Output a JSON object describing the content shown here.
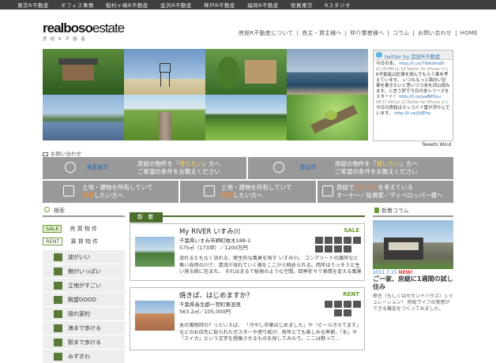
{
  "topnav": {
    "items": [
      "東京R不動産",
      "オフィス事情",
      "稲村ヶ崎R不動産",
      "金沢R不動産",
      "神戸R不動産",
      "福岡R不動産",
      "密買東京",
      "Rスタジオ"
    ]
  },
  "logo": {
    "main": "realboso",
    "main_suffix": "estate",
    "sub": "房総R不動産"
  },
  "headnav": {
    "items": [
      "房総R不動産について",
      "売主・貸主様へ",
      "仲介業者様へ",
      "コラム",
      "お問い合わせ",
      "HOME"
    ],
    "sep": "|"
  },
  "photos": {
    "count": 8
  },
  "twitter": {
    "header": "twitter by 房総R不動産",
    "tweets": [
      {
        "text": "今日の本。",
        "link": "http://t.co/7WkdmdX",
        "meta": "02:09 PM Jul 14 Twitter for iPhone から"
      },
      {
        "text": "R不動産は記事を読んでもらう事を考えています。 いつももっと面白い記事を書きたいと思いつつ本を沢山読みます。と言う訳で今日の本シリーズをスタート！",
        "link": "http://t.co/saB65xu",
        "meta": "09:37 AM Jul 12 Twitter for iPhone から"
      },
      {
        "text": "今日の房総はカッコイイ雲が浮かんでいます。",
        "link": "http://t.co/jVJEhy",
        "meta": ""
      }
    ],
    "footer": "Tweets Wind"
  },
  "inquiry": {
    "label": "お問い合わせ"
  },
  "banners": {
    "rent": {
      "label": "RENT",
      "line1_pre": "房総の物件を「",
      "line1_hl": "借りたい",
      "line1_post": "」方へ",
      "line2": "ご希望の条件をお教えください"
    },
    "buy": {
      "label": "BUY",
      "line1_pre": "房総の物件を「",
      "line1_hl": "買いたい",
      "line1_post": "」方へ",
      "line2": "ご希望の条件をお教えください"
    },
    "build": {
      "line1": "土地・建物を所有していて",
      "line2_hl": "建築",
      "line2_post": "したい方へ"
    },
    "sell": {
      "line1": "土地・建物を所有していて",
      "line2_hl": "売却",
      "line2_post": "したい方へ"
    },
    "biz": {
      "line1_pre": "房総で",
      "line1_hl": "ビジネス",
      "line1_post": "を考えている",
      "line2": "オーナー／投資家／ディベロッパー様へ"
    }
  },
  "sidebar": {
    "title": "検索",
    "sale": {
      "badge": "SALE",
      "label": "売 買 物 件"
    },
    "rent": {
      "badge": "RENT",
      "label": "賃 貸 物 件"
    },
    "categories": [
      "波がいい",
      "樹がいっぱい",
      "立地がすごい",
      "眺望GOOD",
      "隠れ家的",
      "海まで歩ける",
      "駅まで歩ける",
      "みずぎわ"
    ]
  },
  "main": {
    "title": "新 着",
    "cards": [
      {
        "title": "My RIVER いすみ川",
        "tag": "SALE",
        "address": "千葉県いすみ市岬町椎木188-1",
        "price": "575㎡（173坪）／1200万円",
        "desc": "流れるともなく流れる、原生的な風景を残す いすみ川。 コンクリートの護岸など無い自然の川で、清流が流れていく様をここから眺められる。両岸はうっそうと生い茂る緑に包まれ、 それはまるで秘境のような空間。四季折々で表情を変える風景が広がる。 川岸..."
      },
      {
        "title": "焼きぱ、はじめますか？",
        "tag": "RENT",
        "address": "千葉県長生郡一宮町東浪見",
        "price": "563.2㎡／105,000円",
        "desc": "夏の風物詩の？っといえば、 「冷やし中華はじめました」や「ビール冷えてます」などのお店先に貼られたポスターや張り紙が、毎年とても楽しみな季節。「氷」や「スイカ」という文字を想像させるものを探してみたり、ここは黙って..."
      }
    ]
  },
  "right": {
    "title": "新着コラム",
    "date": "2011.7.15",
    "date_new": "NEW!",
    "headline": "ご一家、房総に1週間の試し住み",
    "desc": "移住（もしくはセカンドハウス）シミュレーション！ 房総ライフの実感ができる機会をつくってみました。"
  }
}
